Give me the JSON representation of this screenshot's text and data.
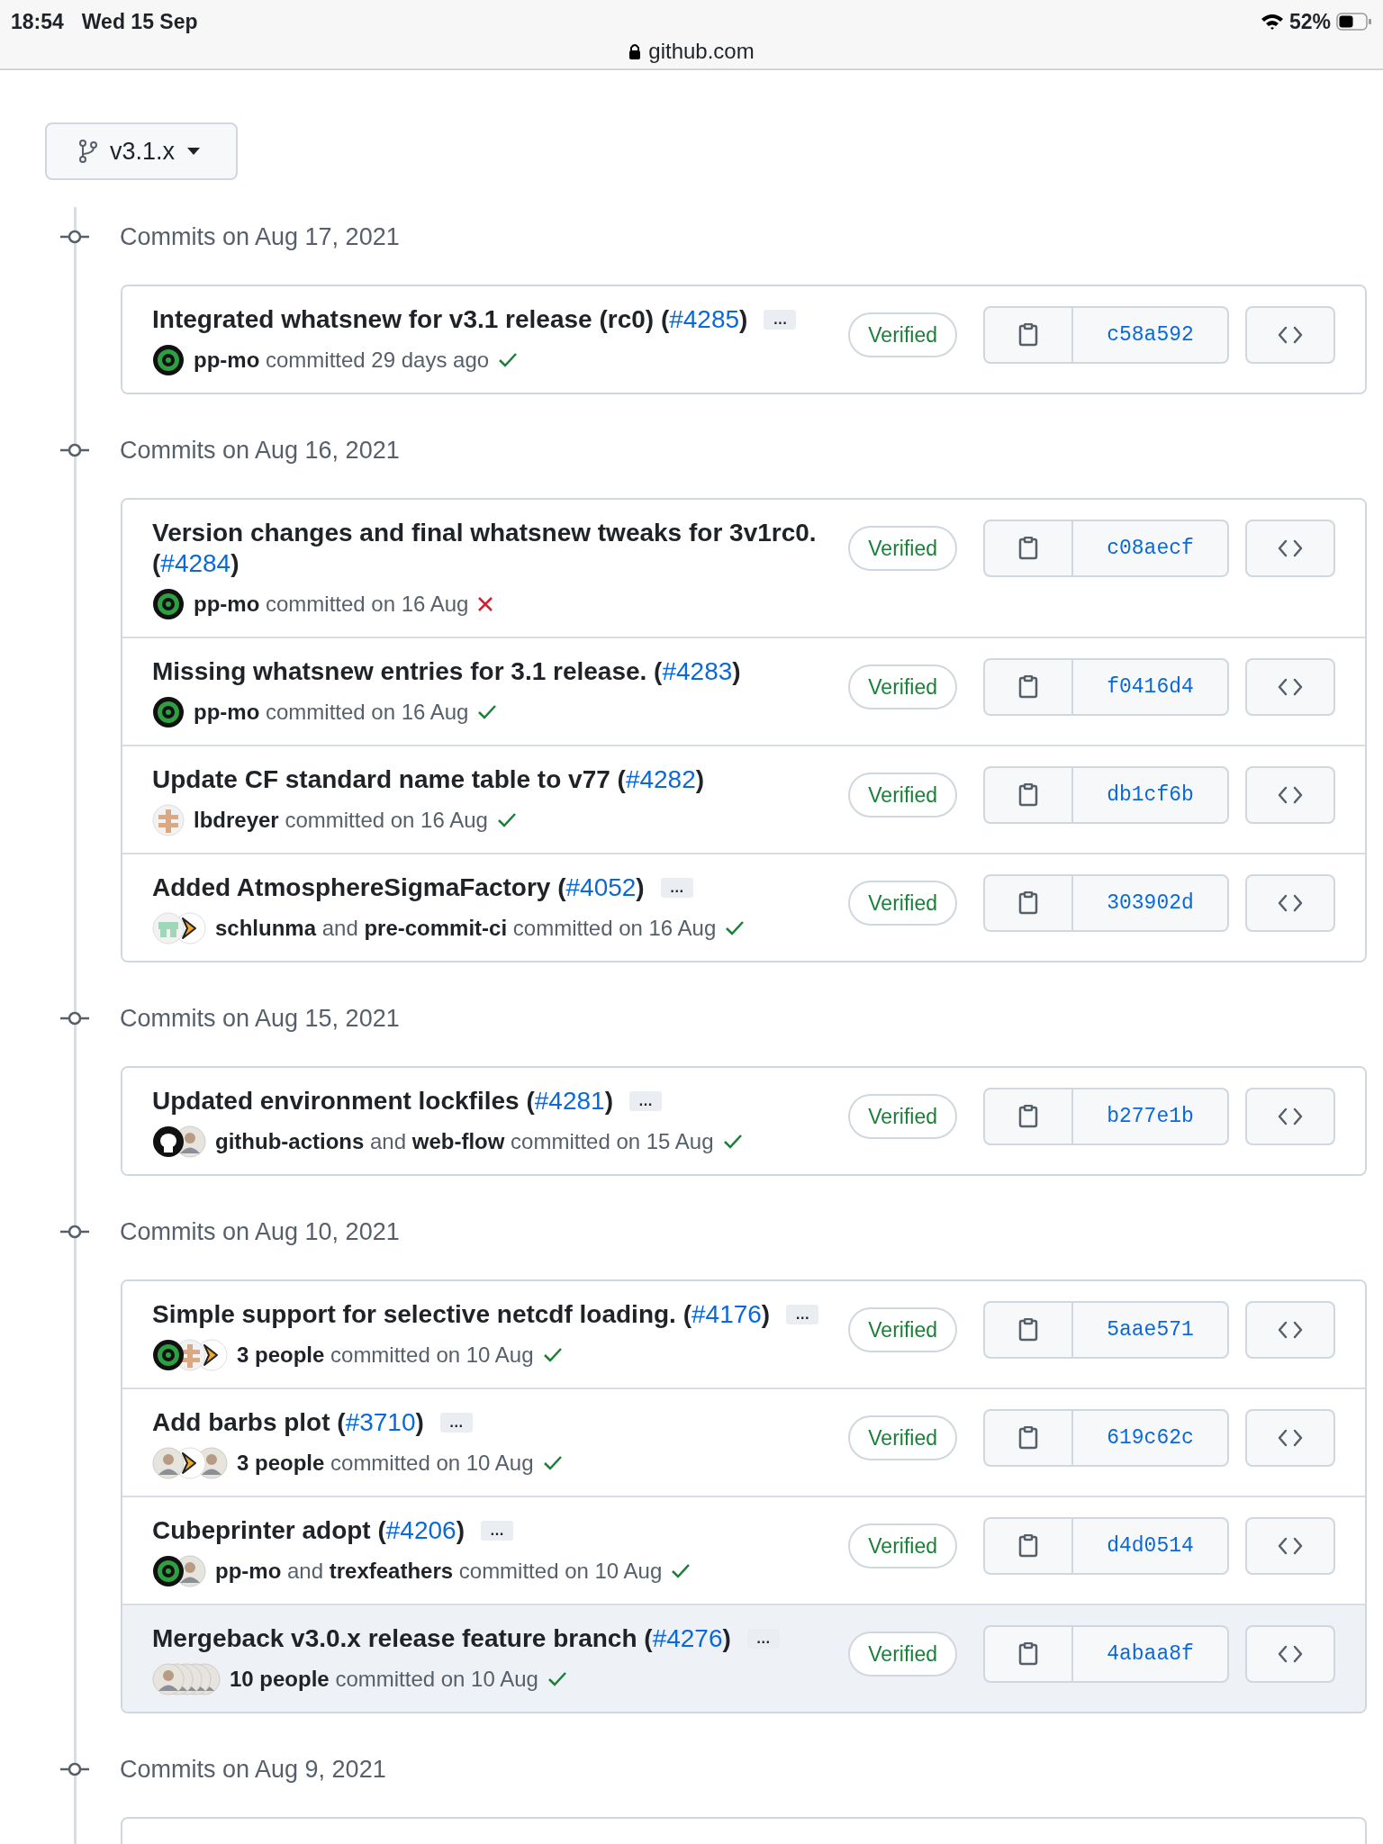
{
  "status_bar": {
    "time": "18:54",
    "date": "Wed 15 Sep",
    "battery": "52%",
    "url": "github.com"
  },
  "branch": {
    "label": "v3.1.x"
  },
  "groups": [
    {
      "heading": "Commits on Aug 17, 2021",
      "commits": [
        {
          "title": "Integrated whatsnew for v3.1 release (rc0) (",
          "pr": "#4285",
          "title_end": ")",
          "expand": "…",
          "avatars": [
            {
              "kind": "target"
            }
          ],
          "byline": "**pp-mo** committed 29 days ago",
          "passed": true,
          "verified": "Verified",
          "hash": "c58a592",
          "highlighted": false
        }
      ]
    },
    {
      "heading": "Commits on Aug 16, 2021",
      "commits": [
        {
          "title": "Version changes and final whatsnew tweaks for 3v1rc0. (",
          "pr": "#4284",
          "title_end": ")",
          "avatars": [
            {
              "kind": "target"
            }
          ],
          "byline": "**pp-mo** committed on 16 Aug",
          "passed": false,
          "verified": "Verified",
          "hash": "c08aecf",
          "highlighted": false
        },
        {
          "title": "Missing whatsnew entries for 3.1 release. (",
          "pr": "#4283",
          "title_end": ")",
          "avatars": [
            {
              "kind": "target"
            }
          ],
          "byline": "**pp-mo** committed on 16 Aug",
          "passed": true,
          "verified": "Verified",
          "hash": "f0416d4",
          "highlighted": false
        },
        {
          "title": "Update CF standard name table to v77 (",
          "pr": "#4282",
          "title_end": ")",
          "avatars": [
            {
              "kind": "tan"
            }
          ],
          "byline": "**lbdreyer** committed on 16 Aug",
          "passed": true,
          "verified": "Verified",
          "hash": "db1cf6b",
          "highlighted": false
        },
        {
          "title": "Added AtmosphereSigmaFactory (",
          "pr": "#4052",
          "title_end": ")",
          "expand": "…",
          "avatars": [
            {
              "kind": "mint"
            },
            {
              "kind": "bot"
            }
          ],
          "byline": "**schlunma** and **pre-commit-ci** committed on 16 Aug",
          "passed": true,
          "verified": "Verified",
          "hash": "303902d",
          "highlighted": false
        }
      ]
    },
    {
      "heading": "Commits on Aug 15, 2021",
      "commits": [
        {
          "title": "Updated environment lockfiles (",
          "pr": "#4281",
          "title_end": ")",
          "expand": "…",
          "avatars": [
            {
              "kind": "octo"
            },
            {
              "kind": "person"
            }
          ],
          "byline": "**github-actions** and **web-flow** committed on 15 Aug",
          "passed": true,
          "verified": "Verified",
          "hash": "b277e1b",
          "highlighted": false
        }
      ]
    },
    {
      "heading": "Commits on Aug 10, 2021",
      "commits": [
        {
          "title": "Simple support for selective netcdf loading. (",
          "pr": "#4176",
          "title_end": ")",
          "expand": "…",
          "avatars": [
            {
              "kind": "target"
            },
            {
              "kind": "tan"
            },
            {
              "kind": "bot"
            }
          ],
          "byline": "**3 people** committed on 10 Aug",
          "passed": true,
          "verified": "Verified",
          "hash": "5aae571",
          "highlighted": false
        },
        {
          "title": "Add barbs plot (",
          "pr": "#3710",
          "title_end": ")",
          "expand": "…",
          "avatars": [
            {
              "kind": "person"
            },
            {
              "kind": "bot"
            },
            {
              "kind": "person"
            }
          ],
          "byline": "**3 people** committed on 10 Aug",
          "passed": true,
          "verified": "Verified",
          "hash": "619c62c",
          "highlighted": false
        },
        {
          "title": "Cubeprinter adopt (",
          "pr": "#4206",
          "title_end": ")",
          "expand": "…",
          "avatars": [
            {
              "kind": "target"
            },
            {
              "kind": "person"
            }
          ],
          "byline": "**pp-mo** and **trexfeathers** committed on 10 Aug",
          "passed": true,
          "verified": "Verified",
          "hash": "d4d0514",
          "highlighted": false
        },
        {
          "title": "Mergeback v3.0.x release feature branch (",
          "pr": "#4276",
          "title_end": ")",
          "expand": "…",
          "avatars": [
            {
              "kind": "person"
            },
            {
              "kind": "person"
            },
            {
              "kind": "person"
            },
            {
              "kind": "person"
            },
            {
              "kind": "person"
            }
          ],
          "byline": "**10 people** committed on 10 Aug",
          "passed": true,
          "verified": "Verified",
          "hash": "4abaa8f",
          "highlighted": true
        }
      ]
    },
    {
      "heading": "Commits on Aug 9, 2021"
    }
  ]
}
